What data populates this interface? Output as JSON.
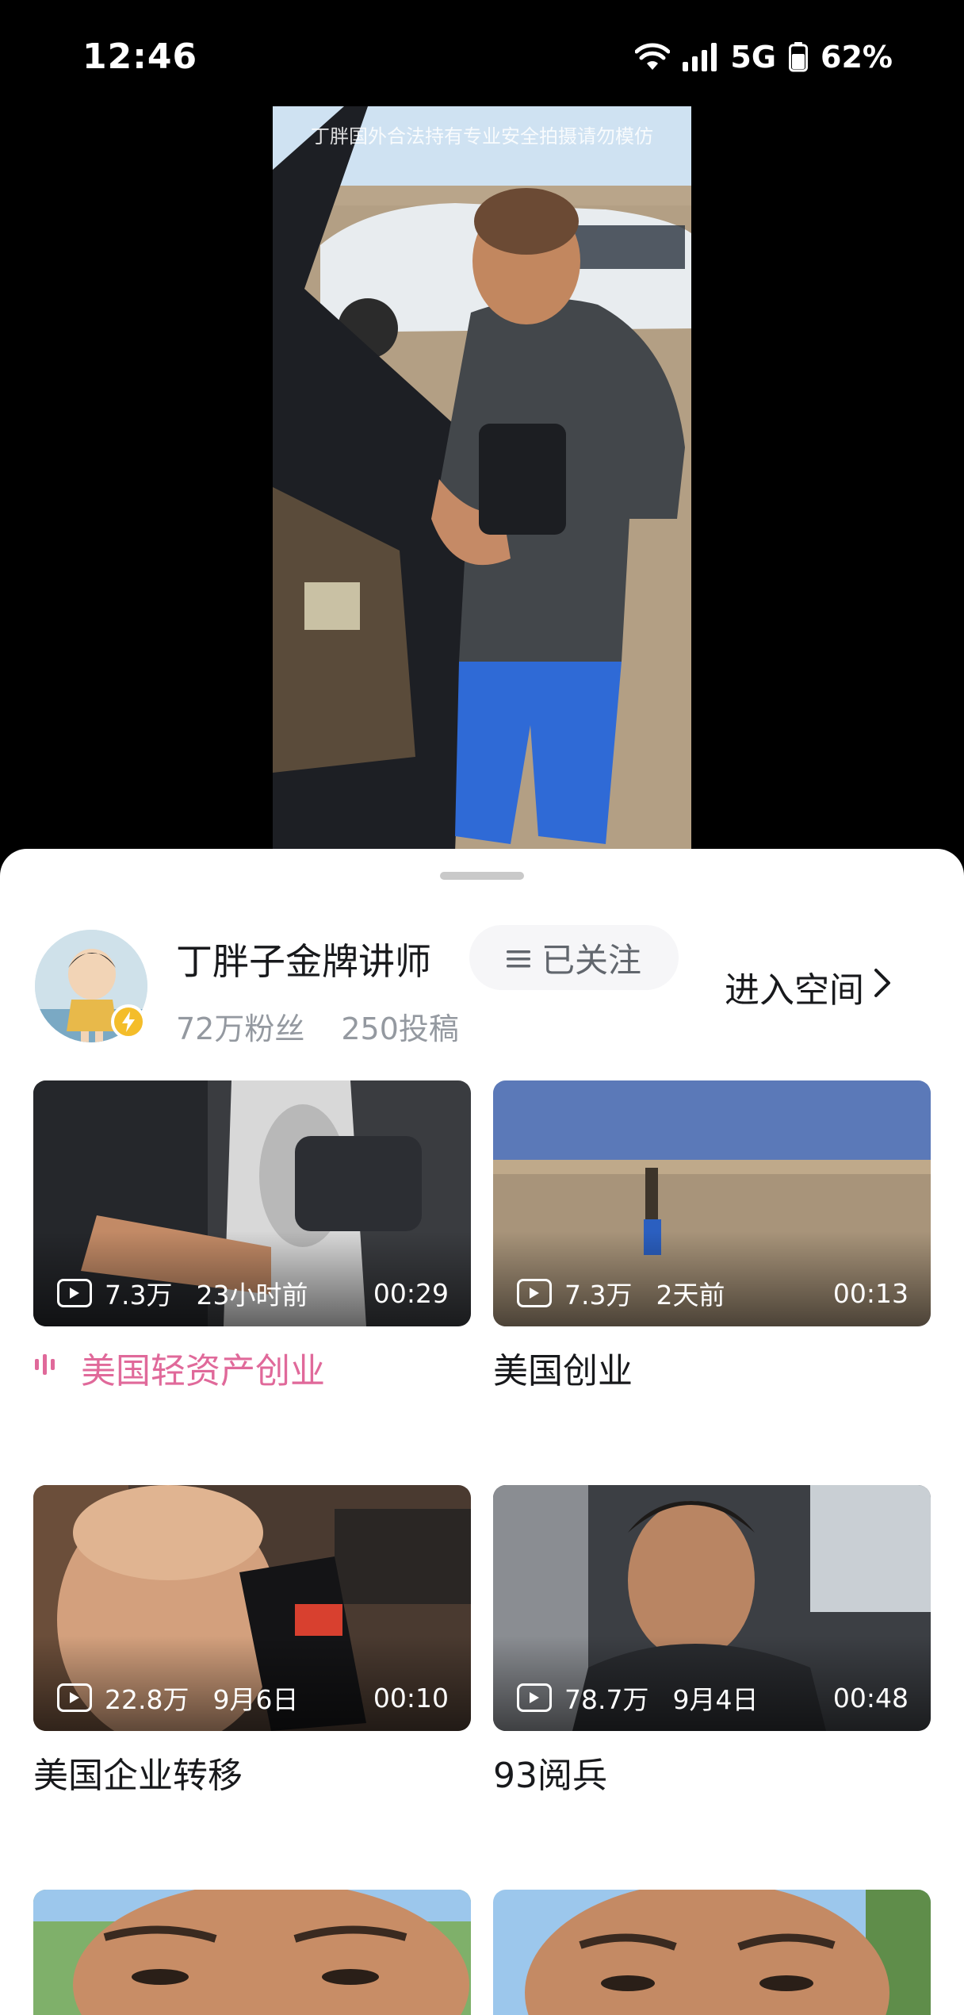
{
  "status_bar": {
    "time": "12:46",
    "network": "5G",
    "battery": "62%"
  },
  "video": {
    "watermark": "丁胖国外合法持有专业安全拍摄请勿模仿"
  },
  "profile": {
    "name": "丁胖子金牌讲师",
    "followers": "72万粉丝",
    "posts": "250投稿",
    "follow_label": "已关注",
    "enter_space_label": "进入空间"
  },
  "videos": [
    {
      "views": "7.3万",
      "date": "23小时前",
      "duration": "00:29",
      "title": "美国轻资产创业",
      "playing": true
    },
    {
      "views": "7.3万",
      "date": "2天前",
      "duration": "00:13",
      "title": "美国创业",
      "playing": false
    },
    {
      "views": "22.8万",
      "date": "9月6日",
      "duration": "00:10",
      "title": "美国企业转移",
      "playing": false
    },
    {
      "views": "78.7万",
      "date": "9月4日",
      "duration": "00:48",
      "title": "93阅兵",
      "playing": false
    }
  ],
  "colors": {
    "accent_pink": "#e0699a",
    "text_primary": "#18191c",
    "text_secondary": "#9499a0",
    "badge_yellow": "#f4bd2a"
  }
}
